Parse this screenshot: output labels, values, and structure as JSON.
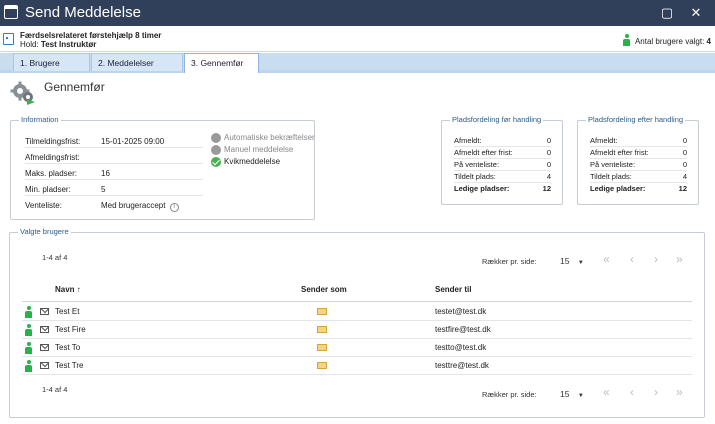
{
  "window": {
    "title": "Send Meddelelse",
    "maximize_glyph": "▢",
    "close_glyph": "✕"
  },
  "header": {
    "course": "Færdselsrelateret førstehjælp 8 timer",
    "hold_label": "Hold:",
    "hold_value": "Test Instruktør",
    "selected_label": "Antal brugere valgt:",
    "selected_count": "4"
  },
  "tabs": [
    {
      "label": "1. Brugere",
      "active": false
    },
    {
      "label": "2. Meddelelser",
      "active": false
    },
    {
      "label": "3. Gennemfør",
      "active": true
    }
  ],
  "page": {
    "title": "Gennemfør"
  },
  "information": {
    "legend": "Information",
    "rows": [
      {
        "label": "Tilmeldingsfrist:",
        "value": "15-01-2025 09:00"
      },
      {
        "label": "Afmeldingsfrist:",
        "value": ""
      },
      {
        "label": "Maks. pladser:",
        "value": "16"
      },
      {
        "label": "Min. pladser:",
        "value": "5"
      },
      {
        "label": "Venteliste:",
        "value": "Med brugeraccept"
      }
    ],
    "options": [
      {
        "label": "Automatiske bekræftelser",
        "checked": false
      },
      {
        "label": "Manuel meddelelse",
        "checked": false
      },
      {
        "label": "Kvikmeddelelse",
        "checked": true
      }
    ]
  },
  "before": {
    "legend": "Pladsfordeling før handling",
    "rows": [
      {
        "label": "Afmeldt:",
        "value": "0"
      },
      {
        "label": "Afmeldt efter frist:",
        "value": "0"
      },
      {
        "label": "På venteliste:",
        "value": "0"
      },
      {
        "label": "Tildelt plads:",
        "value": "4"
      },
      {
        "label": "Ledige pladser:",
        "value": "12"
      }
    ]
  },
  "after": {
    "legend": "Pladsfordeling efter handling",
    "rows": [
      {
        "label": "Afmeldt:",
        "value": "0"
      },
      {
        "label": "Afmeldt efter frist:",
        "value": "0"
      },
      {
        "label": "På venteliste:",
        "value": "0"
      },
      {
        "label": "Tildelt plads:",
        "value": "4"
      },
      {
        "label": "Ledige pladser:",
        "value": "12"
      }
    ]
  },
  "users": {
    "legend": "Valgte brugere",
    "range": "1-4 af 4",
    "rows_per_page_label": "Rækker pr. side:",
    "rows_per_page": "15",
    "nav": {
      "first": "«",
      "prev": "‹",
      "next": "›",
      "last": "»"
    },
    "columns": {
      "name": "Navn",
      "sort_glyph": "↑",
      "sender_as": "Sender som",
      "send_to": "Sender til"
    },
    "rows": [
      {
        "name": "Test Et",
        "email": "testet@test.dk"
      },
      {
        "name": "Test Fire",
        "email": "testfire@test.dk"
      },
      {
        "name": "Test To",
        "email": "testto@test.dk"
      },
      {
        "name": "Test Tre",
        "email": "testtre@test.dk"
      }
    ]
  },
  "icons": {
    "app": "window-icon",
    "calendar": "calendar-icon",
    "user": "person-icon",
    "mail": "mail-icon",
    "envelope": "envelope-icon",
    "gears": "gears-icon",
    "info": "info-icon"
  },
  "colors": {
    "titlebar": "#31405a",
    "tabs": "#c9ddf1",
    "legend": "#2b5c8a",
    "user_green": "#27b24a",
    "check_green": "#4caf50"
  }
}
